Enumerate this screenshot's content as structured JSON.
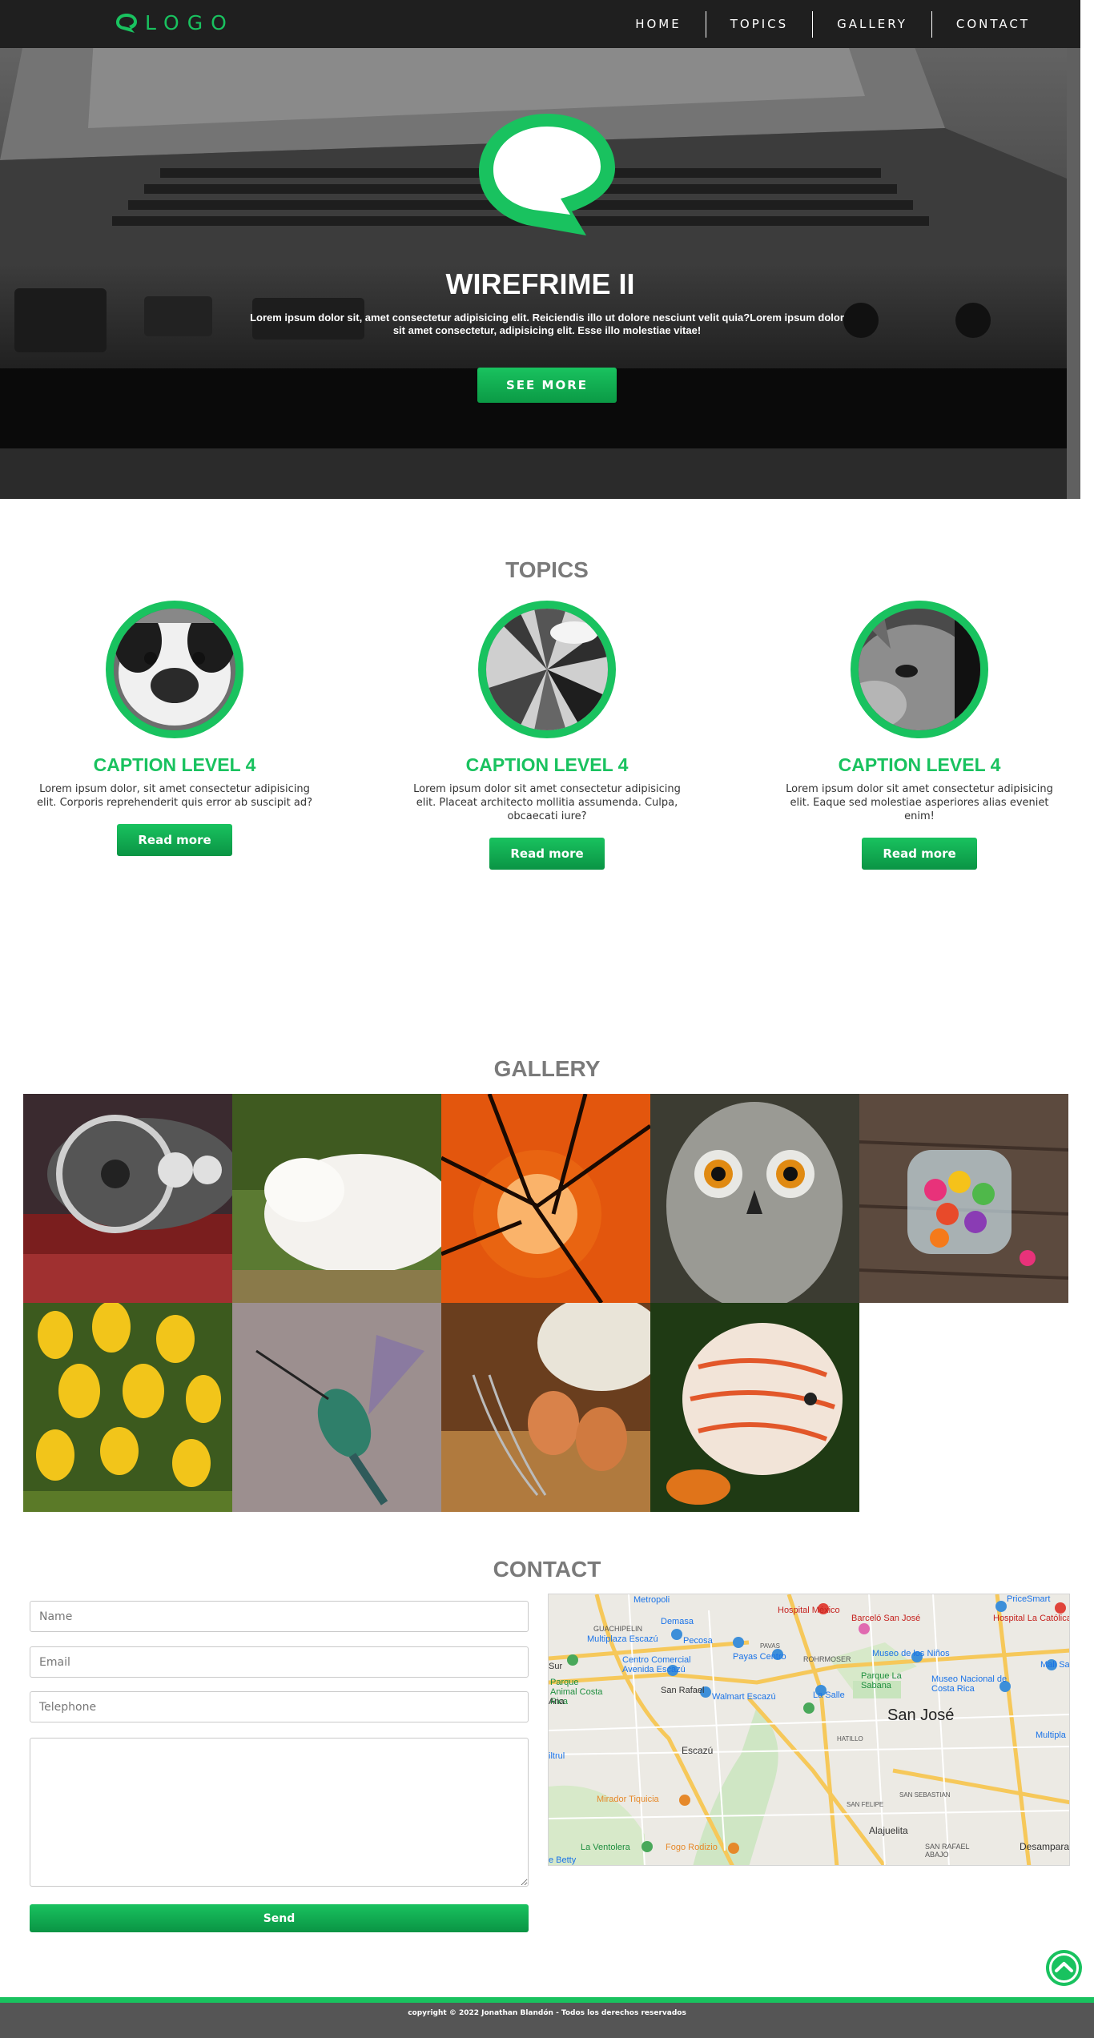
{
  "nav": {
    "logo_text": "LOGO",
    "items": [
      {
        "label": "HOME"
      },
      {
        "label": "TOPICS"
      },
      {
        "label": "GALLERY"
      },
      {
        "label": "CONTACT"
      }
    ]
  },
  "hero": {
    "title": "WIREFRIME II",
    "text": "Lorem ipsum dolor sit, amet consectetur adipisicing elit. Reiciendis illo ut dolore nesciunt velit quia?Lorem ipsum dolor sit amet consectetur, adipisicing elit. Esse illo molestiae vitae!",
    "button": "SEE MORE"
  },
  "topics": {
    "title": "TOPICS",
    "cards": [
      {
        "image": "dog-photo",
        "caption": "CAPTION LEVEL 4",
        "text": "Lorem ipsum dolor, sit amet consectetur adipisicing elit. Corporis reprehenderit quis error ab suscipit ad?",
        "button": "Read more"
      },
      {
        "image": "building-photo",
        "caption": "CAPTION LEVEL 4",
        "text": "Lorem ipsum dolor sit amet consectetur adipisicing elit. Placeat architecto mollitia assumenda. Culpa, obcaecati iure?",
        "button": "Read more"
      },
      {
        "image": "cat-photo",
        "caption": "CAPTION LEVEL 4",
        "text": "Lorem ipsum dolor sit amet consectetur adipisicing elit. Eaque sed molestiae asperiores alias eveniet enim!",
        "button": "Read more"
      }
    ]
  },
  "gallery": {
    "title": "GALLERY",
    "images": [
      "vintage-car-dashboard",
      "sleeping-cat",
      "sunset-tree",
      "owl",
      "candy-jar",
      "yellow-crocus-flowers",
      "hummingbird",
      "eggs-and-flour",
      "discus-fish"
    ]
  },
  "contact": {
    "title": "CONTACT",
    "name_placeholder": "Name",
    "email_placeholder": "Email",
    "telephone_placeholder": "Telephone",
    "send": "Send",
    "map": {
      "city": "San José",
      "labels": [
        "Metropoli",
        "Demasa",
        "Hospital México",
        "Barceló San José",
        "Hospital La Católica",
        "PriceSmart",
        "GUACHIPELIN",
        "Multiplaza Escazú",
        "Pecosa",
        "Museo de los Niños",
        "Mall San Pe",
        "Centro Comercial Avenida Escazú",
        "Payas Centro",
        "ROHRMOSER",
        "PAVAS",
        "Parque La Sabana",
        "Museo Nacional de Costa Rica",
        "Multipla",
        "Parque Animal Costa Rica",
        "San Rafael",
        "Walmart Escazú",
        "La Salle",
        "HATILLO",
        "Escazú",
        "Mirador Tiquicia",
        "SAN SEBASTIAN",
        "SAN FELIPE",
        "Alajuelita",
        "La Ventolera",
        "Fogo Rodizio",
        "SAN RAFAEL ABAJO",
        "Desamparad",
        "e Betty",
        "Sur",
        "Ana",
        "iltrul"
      ]
    }
  },
  "footer": {
    "copyright": "copyright © 2022 Jonathan Blandón - Todos los derechos reservados"
  }
}
